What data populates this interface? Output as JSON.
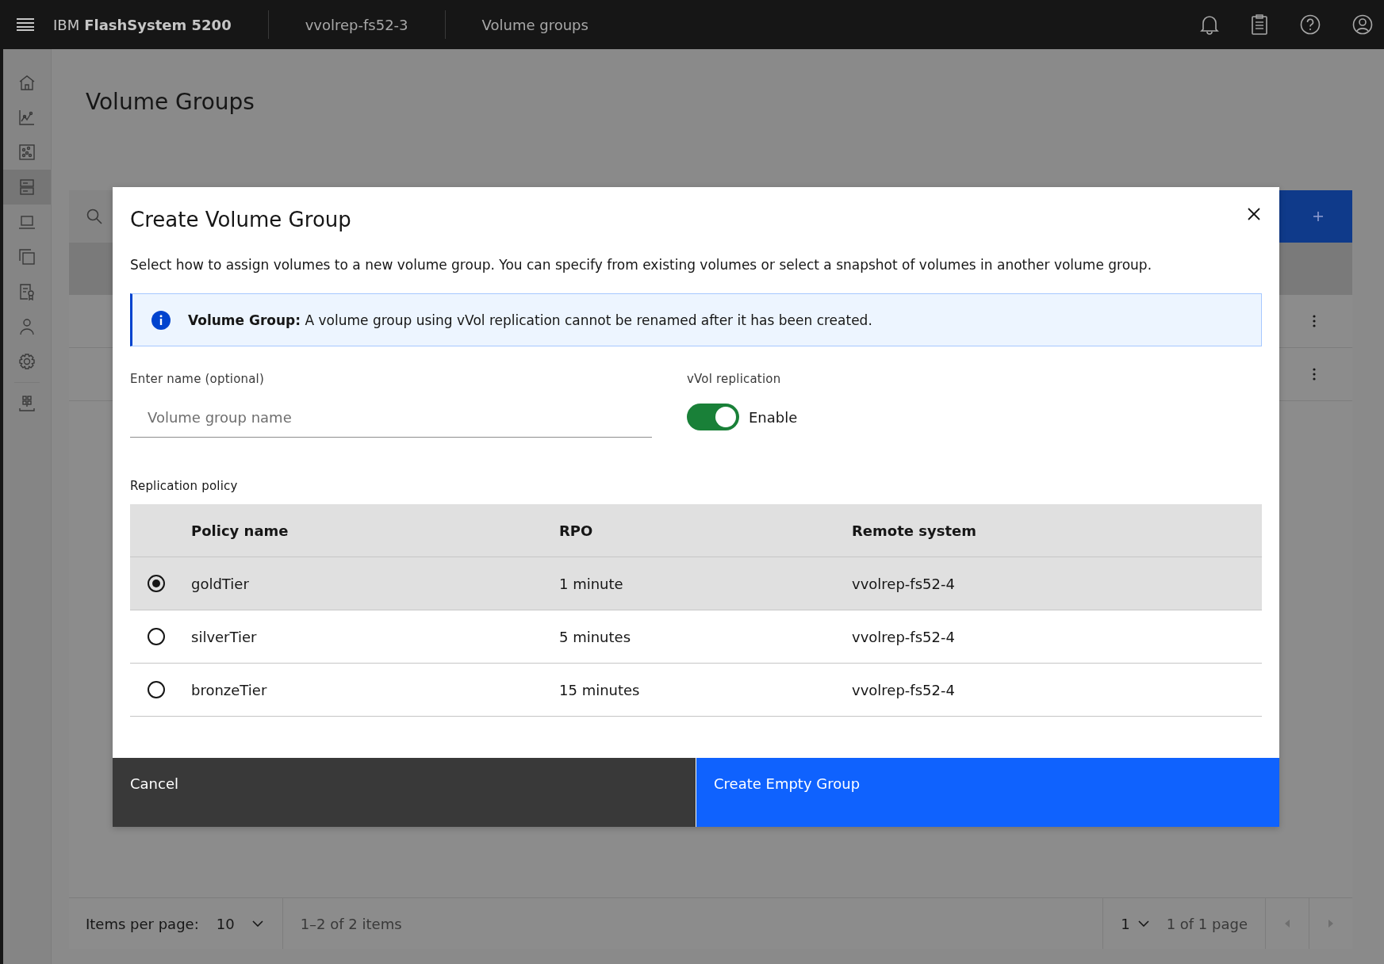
{
  "header": {
    "brand_prefix": "IBM",
    "brand_name": "FlashSystem 5200",
    "system": "vvolrep-fs52-3",
    "page": "Volume groups"
  },
  "sidebar": {
    "items": [
      {
        "selected": false
      },
      {
        "selected": false
      },
      {
        "selected": false
      },
      {
        "selected": true
      },
      {
        "selected": false
      },
      {
        "selected": false
      },
      {
        "selected": false
      },
      {
        "selected": false
      },
      {
        "selected": false
      },
      {
        "selected": false
      }
    ]
  },
  "page_title": "Volume Groups",
  "pagination": {
    "items_per_page_label": "Items per page:",
    "items_per_page": "10",
    "range": "1–2 of 2 items",
    "page": "1",
    "page_range": "1 of 1 page"
  },
  "dialog": {
    "title": "Create Volume Group",
    "description": "Select how to assign volumes to a new volume group. You can specify from existing volumes or select a snapshot of volumes in another volume group.",
    "notification": "**Volume Group:** A volume group using vVol replication cannot be renamed after it has been created.",
    "name_field": {
      "label": "Enter name (optional)",
      "placeholder": "Volume group name"
    },
    "replication": {
      "label": "vVol replication",
      "on": true,
      "text": "Enable"
    },
    "policy_label": "Replication policy",
    "columns": [
      "Policy name",
      "RPO",
      "Remote system"
    ],
    "rows": [
      {
        "name": "goldTier",
        "rpo": "1 minute",
        "remote": "vvolrep-fs52-4",
        "selected": true
      },
      {
        "name": "silverTier",
        "rpo": "5 minutes",
        "remote": "vvolrep-fs52-4",
        "selected": false
      },
      {
        "name": "bronzeTier",
        "rpo": "15 minutes",
        "remote": "vvolrep-fs52-4",
        "selected": false
      }
    ],
    "buttons": {
      "secondary": "Cancel",
      "primary": "Create Empty Group"
    }
  }
}
